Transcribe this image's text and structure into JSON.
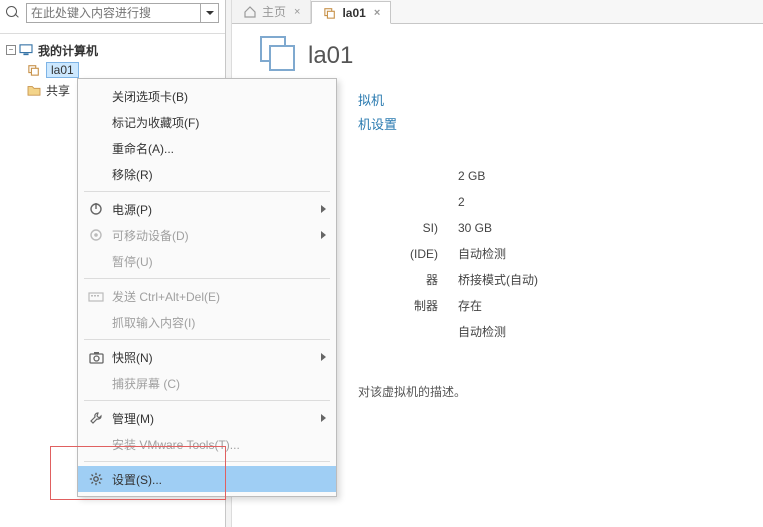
{
  "sidebar": {
    "search_placeholder": "在此处键入内容进行搜",
    "tree": {
      "root_label": "我的计算机",
      "items": [
        {
          "label": "la01",
          "selected": true
        },
        {
          "label": "共享"
        }
      ]
    }
  },
  "tabs": {
    "home_label": "主页",
    "vm_label": "la01"
  },
  "main": {
    "title": "la01",
    "action_links": {
      "power": "拟机",
      "edit": "机设置"
    },
    "hardware": [
      {
        "label": "",
        "value": "2 GB"
      },
      {
        "label": "",
        "value": "2"
      },
      {
        "label": "SI)",
        "value": "30 GB"
      },
      {
        "label": "(IDE)",
        "value": "自动检测"
      },
      {
        "label": "器",
        "value": "桥接模式(自动)"
      },
      {
        "label": "制器",
        "value": "存在"
      },
      {
        "label": "",
        "value": "自动检测"
      }
    ],
    "description": "对该虚拟机的描述。"
  },
  "context_menu": {
    "items": [
      {
        "key": "close-tab",
        "label": "关闭选项卡(B)",
        "icon": null,
        "enabled": true,
        "submenu": false
      },
      {
        "key": "favorite",
        "label": "标记为收藏项(F)",
        "icon": null,
        "enabled": true,
        "submenu": false
      },
      {
        "key": "rename",
        "label": "重命名(A)...",
        "icon": null,
        "enabled": true,
        "submenu": false
      },
      {
        "key": "remove",
        "label": "移除(R)",
        "icon": null,
        "enabled": true,
        "submenu": false
      },
      {
        "sep": true
      },
      {
        "key": "power",
        "label": "电源(P)",
        "icon": "power",
        "enabled": true,
        "submenu": true
      },
      {
        "key": "removable",
        "label": "可移动设备(D)",
        "icon": "device",
        "enabled": false,
        "submenu": true
      },
      {
        "key": "pause",
        "label": "暂停(U)",
        "icon": null,
        "enabled": false,
        "submenu": false
      },
      {
        "sep": true
      },
      {
        "key": "sendcad",
        "label": "发送 Ctrl+Alt+Del(E)",
        "icon": "kbd",
        "enabled": false,
        "submenu": false
      },
      {
        "key": "grabinput",
        "label": "抓取输入内容(I)",
        "icon": null,
        "enabled": false,
        "submenu": false
      },
      {
        "sep": true
      },
      {
        "key": "snapshot",
        "label": "快照(N)",
        "icon": "snap",
        "enabled": true,
        "submenu": true
      },
      {
        "key": "capture",
        "label": "捕获屏幕 (C)",
        "icon": null,
        "enabled": false,
        "submenu": false
      },
      {
        "sep": true
      },
      {
        "key": "manage",
        "label": "管理(M)",
        "icon": "wrench",
        "enabled": true,
        "submenu": true
      },
      {
        "key": "vmtools",
        "label": "安装 VMware Tools(T)...",
        "icon": null,
        "enabled": false,
        "submenu": false
      },
      {
        "sep": true
      },
      {
        "key": "settings",
        "label": "设置(S)...",
        "icon": "gear",
        "enabled": true,
        "submenu": false,
        "highlighted": true
      }
    ]
  }
}
